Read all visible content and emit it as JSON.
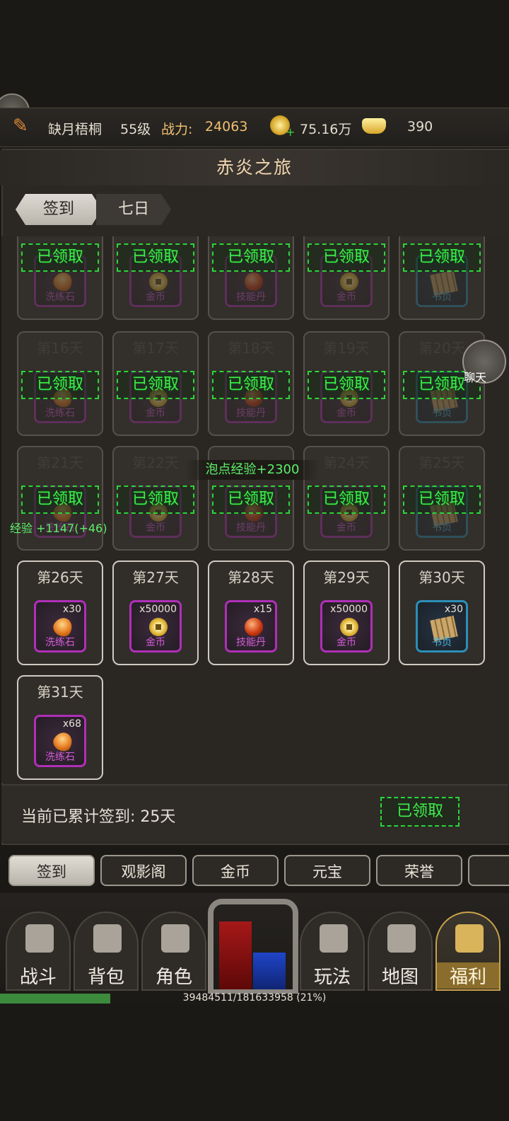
{
  "header": {
    "name": "缺月梧桐",
    "level": "55级",
    "power_label": "战力:",
    "power_value": "24063",
    "gold": "75.16万",
    "yuanbao": "390"
  },
  "panel": {
    "title": "赤炎之旅",
    "tabs": [
      "签到",
      "七日"
    ]
  },
  "days": [
    {
      "day": "",
      "item": "洗练石",
      "qty": "",
      "kind": "gem",
      "claimed": true
    },
    {
      "day": "",
      "item": "金币",
      "qty": "",
      "kind": "coin",
      "claimed": true
    },
    {
      "day": "",
      "item": "技能丹",
      "qty": "",
      "kind": "pill",
      "claimed": true
    },
    {
      "day": "",
      "item": "金币",
      "qty": "",
      "kind": "coin",
      "claimed": true
    },
    {
      "day": "",
      "item": "书页",
      "qty": "",
      "kind": "book",
      "claimed": true
    },
    {
      "day": "第16天",
      "item": "洗练石",
      "qty": "",
      "kind": "gem",
      "claimed": true
    },
    {
      "day": "第17天",
      "item": "金币",
      "qty": "",
      "kind": "coin",
      "claimed": true
    },
    {
      "day": "第18天",
      "item": "技能丹",
      "qty": "",
      "kind": "pill",
      "claimed": true
    },
    {
      "day": "第19天",
      "item": "金币",
      "qty": "",
      "kind": "coin",
      "claimed": true
    },
    {
      "day": "第20天",
      "item": "书页",
      "qty": "",
      "kind": "book",
      "claimed": true
    },
    {
      "day": "第21天",
      "item": "洗练石",
      "qty": "",
      "kind": "gem",
      "claimed": true
    },
    {
      "day": "第22天",
      "item": "金币",
      "qty": "",
      "kind": "coin",
      "claimed": true
    },
    {
      "day": "",
      "item": "技能丹",
      "qty": "",
      "kind": "pill",
      "claimed": true
    },
    {
      "day": "第24天",
      "item": "金币",
      "qty": "",
      "kind": "coin",
      "claimed": true
    },
    {
      "day": "第25天",
      "item": "书页",
      "qty": "",
      "kind": "book",
      "claimed": true
    },
    {
      "day": "第26天",
      "item": "洗练石",
      "qty": "x30",
      "kind": "gem",
      "claimed": false
    },
    {
      "day": "第27天",
      "item": "金币",
      "qty": "x50000",
      "kind": "coin",
      "claimed": false
    },
    {
      "day": "第28天",
      "item": "技能丹",
      "qty": "x15",
      "kind": "pill",
      "claimed": false
    },
    {
      "day": "第29天",
      "item": "金币",
      "qty": "x50000",
      "kind": "coin",
      "claimed": false
    },
    {
      "day": "第30天",
      "item": "书页",
      "qty": "x30",
      "kind": "book",
      "claimed": false
    },
    {
      "day": "第31天",
      "item": "洗练石",
      "qty": "x68",
      "kind": "gem",
      "claimed": false
    }
  ],
  "claimed_label": "已领取",
  "float_texts": {
    "exp_bubble": "泡点经验+2300",
    "exp_gain": "经验 +1147(+46)"
  },
  "chat": {
    "label": "聊天"
  },
  "cumulative": {
    "label": "当前已累计签到:",
    "value": "25天",
    "status": "已领取"
  },
  "bottom_tabs": [
    "签到",
    "观影阁",
    "金币",
    "元宝",
    "荣誉"
  ],
  "nav": [
    {
      "label": "战斗",
      "icon": "swords-icon"
    },
    {
      "label": "背包",
      "icon": "backpack-icon"
    },
    {
      "label": "角色",
      "icon": "character-icon"
    },
    {
      "label": "玩法",
      "icon": "gameplay-icon"
    },
    {
      "label": "地图",
      "icon": "map-icon"
    },
    {
      "label": "福利",
      "icon": "chest-icon"
    }
  ],
  "exp": {
    "text": "39484511/181633958 (21%)",
    "fraction": 0.21
  }
}
